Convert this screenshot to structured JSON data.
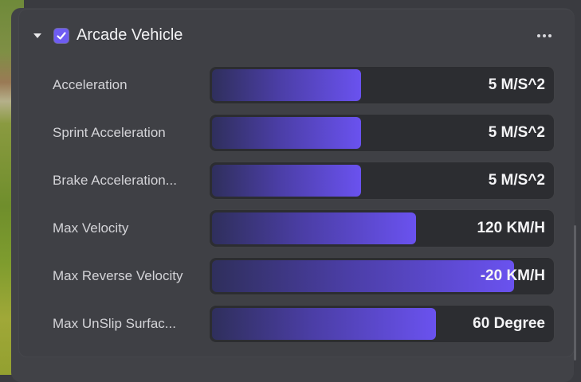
{
  "component": {
    "title": "Arcade Vehicle",
    "enabled": true
  },
  "properties": [
    {
      "label": "Acceleration",
      "value": "5 M/S^2",
      "fill": 0.44
    },
    {
      "label": "Sprint Acceleration",
      "value": "5 M/S^2",
      "fill": 0.44
    },
    {
      "label": "Brake Acceleration...",
      "value": "5 M/S^2",
      "fill": 0.44
    },
    {
      "label": "Max Velocity",
      "value": "120 KM/H",
      "fill": 0.6
    },
    {
      "label": "Max Reverse Velocity",
      "value": "-20 KM/H",
      "fill": 0.89
    },
    {
      "label": "Max UnSlip Surfac...",
      "value": "60 Degree",
      "fill": 0.66
    }
  ],
  "colors": {
    "accent": "#6a52ef",
    "panel": "#3f4045",
    "field": "#2c2d31"
  },
  "icons": {
    "collapse": "caret-down-icon",
    "check": "checkmark-icon",
    "more": "more-horizontal-icon"
  }
}
